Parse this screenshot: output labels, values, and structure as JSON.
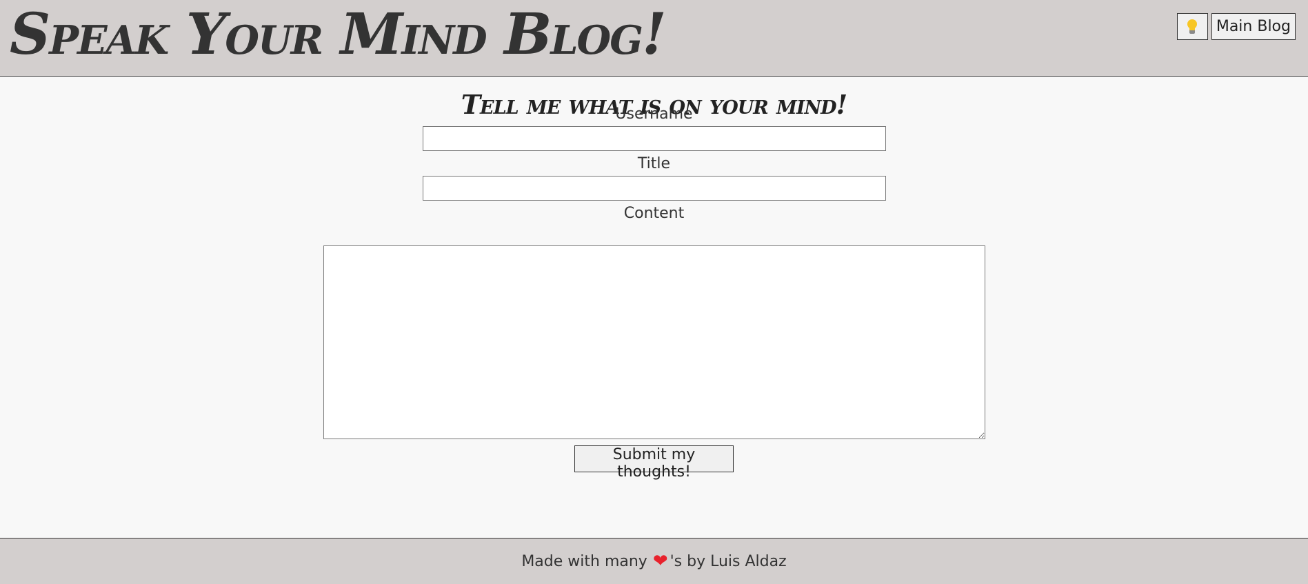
{
  "header": {
    "site_title": "Speak Your Mind Blog!",
    "theme_icon": "lightbulb-icon",
    "main_blog_label": "Main Blog"
  },
  "form": {
    "heading": "Tell me what is on your mind!",
    "username_label": "Username",
    "username_value": "",
    "title_label": "Title",
    "title_value": "",
    "content_label": "Content",
    "content_value": "",
    "submit_label": "Submit my thoughts!"
  },
  "footer": {
    "prefix": "Made with many",
    "heart_icon": "heart-icon",
    "suffix": "'s by Luis Aldaz"
  },
  "colors": {
    "header_bg": "#d3cfce",
    "page_bg": "#f8f8f8",
    "heart": "#e8222c",
    "bulb": "#f7c624"
  }
}
